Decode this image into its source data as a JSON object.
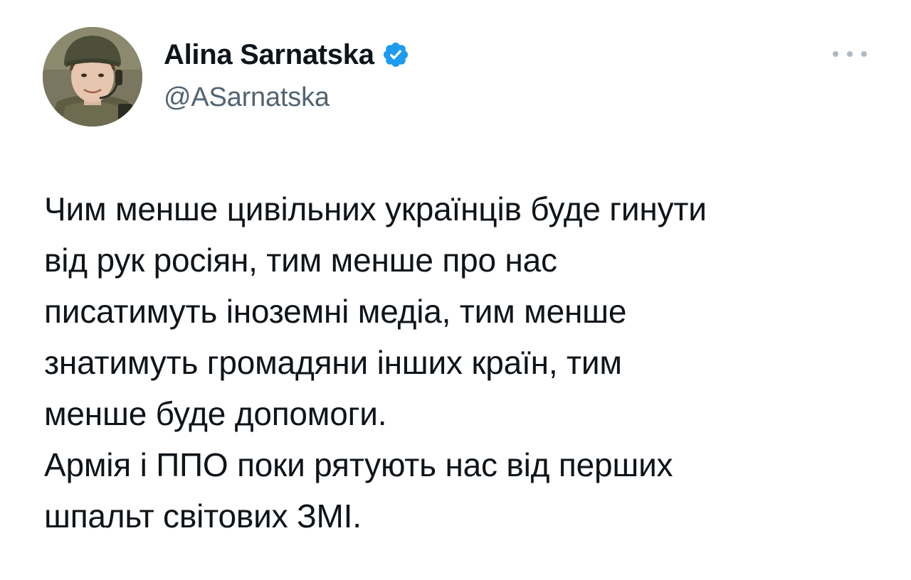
{
  "author": {
    "display_name": "Alina Sarnatska",
    "handle": "@ASarnatska",
    "verified": true,
    "avatar_icon": "profile-photo-helmet"
  },
  "menu": {
    "icon": "more-options-icon"
  },
  "tweet": {
    "text": "Чим менше цивільних українців буде гинути\nвід рук росіян, тим менше про нас\nписатимуть іноземні медіа, тим менше\nзнатимуть громадяни інших країн, тим\nменше буде допомоги.\nАрмія і ППО поки рятують нас від перших\nшпальт світових ЗМІ."
  },
  "colors": {
    "verified_badge": "#1d9bf0",
    "handle": "#536471",
    "text": "#0f1419"
  }
}
